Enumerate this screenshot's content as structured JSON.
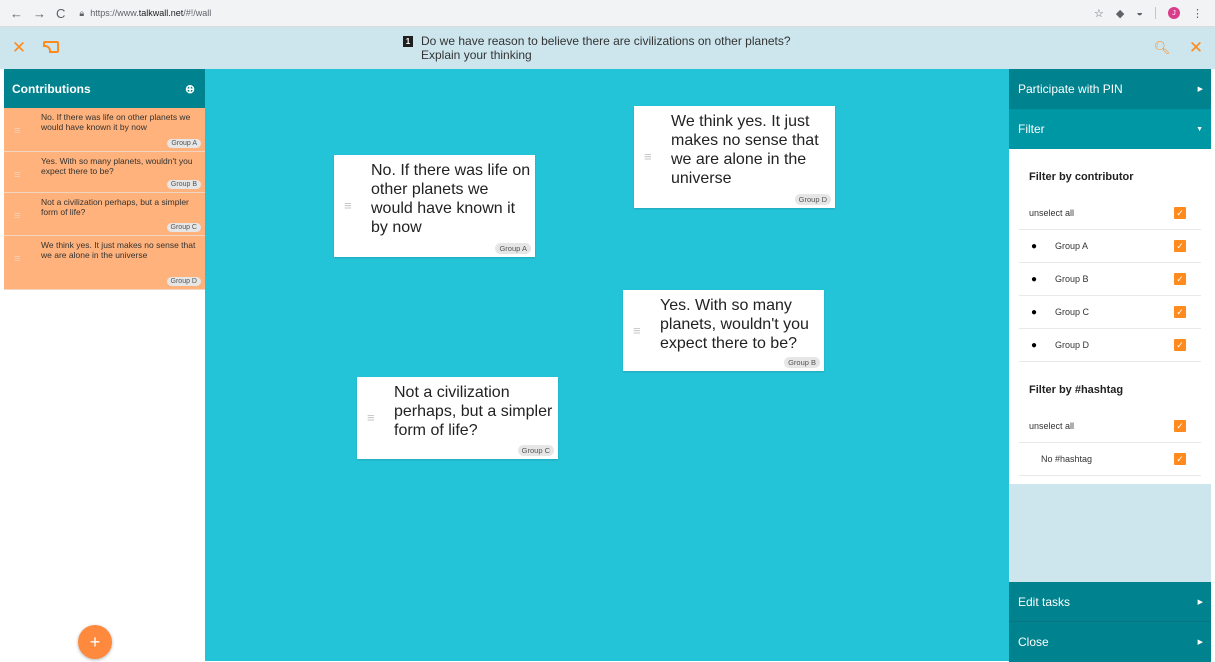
{
  "browser": {
    "url_prefix": "https://www.",
    "url_host": "talkwall.net",
    "url_suffix": "/#!/wall",
    "profile_initial": "J"
  },
  "header": {
    "task_number": "1",
    "question_line1": "Do we have reason to believe there are civilizations on other planets?",
    "question_line2": "Explain your thinking"
  },
  "sidebar": {
    "title": "Contributions",
    "items": [
      {
        "text": "No. If there was life on other planets we would have known it by now",
        "group": "Group A"
      },
      {
        "text": "Yes. With so many planets, wouldn't you expect there to be?",
        "group": "Group B"
      },
      {
        "text": "Not a civilization perhaps, but a simpler form of life?",
        "group": "Group C"
      },
      {
        "text": "We think yes. It just makes no sense that we are alone in the universe",
        "group": "Group D"
      }
    ],
    "fab_label": "+"
  },
  "wall": {
    "notes": [
      {
        "text": "No. If there was life on other planets we would have known it by now",
        "group": "Group A"
      },
      {
        "text": "We think yes. It just makes no sense that we are alone in the universe",
        "group": "Group D"
      },
      {
        "text": "Yes. With so many planets, wouldn't you expect there to be?",
        "group": "Group B"
      },
      {
        "text": "Not a civilization perhaps, but a simpler form of life?",
        "group": "Group C"
      }
    ]
  },
  "rightpanel": {
    "participate_label": "Participate with PIN",
    "filter_label": "Filter",
    "filter_contributor_title": "Filter by contributor",
    "unselect_all": "unselect all",
    "contributors": [
      "Group A",
      "Group B",
      "Group C",
      "Group D"
    ],
    "filter_hashtag_title": "Filter by #hashtag",
    "hashtags": [
      "No #hashtag"
    ],
    "edit_tasks_label": "Edit tasks",
    "close_label": "Close"
  },
  "colors": {
    "accent": "#ff8a1e",
    "teal": "#00838f",
    "wall": "#24c4d8",
    "contribution": "#ffb27b"
  }
}
